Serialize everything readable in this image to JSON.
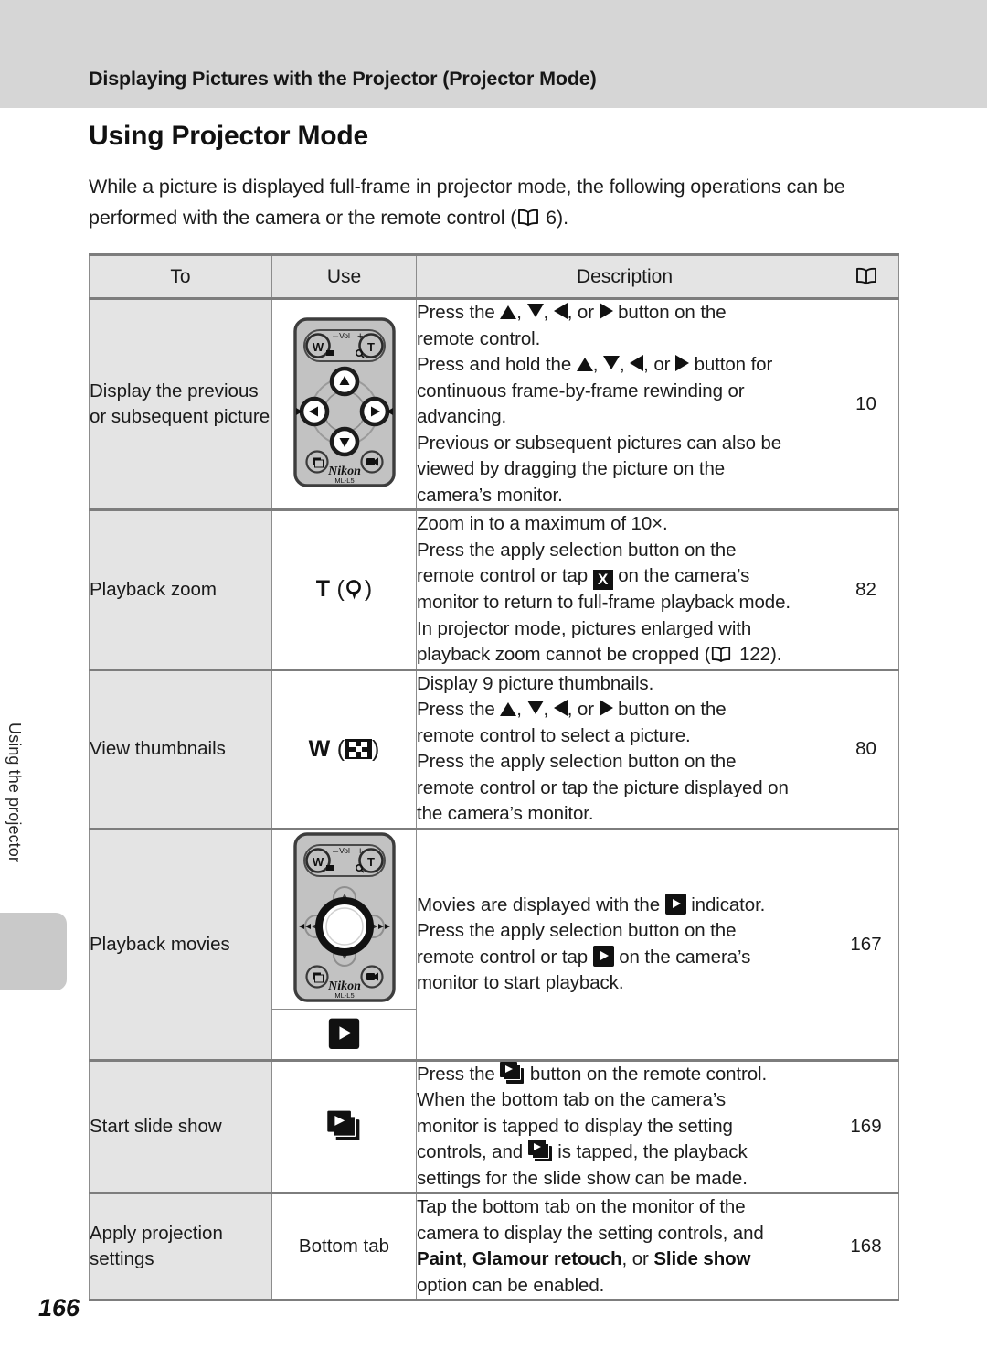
{
  "running_head": "Displaying Pictures with the Projector (Projector Mode)",
  "side_tab": "Using the projector",
  "page_number": "166",
  "section": {
    "title": "Using Projector Mode",
    "intro_line1": "While a picture is displayed full-frame in projector mode, the following operations",
    "intro_line2_before": "can be performed with the camera or the remote control (",
    "intro_line2_after": " 6)."
  },
  "table": {
    "headers": {
      "to": "To",
      "use": "Use",
      "description": "Description",
      "page_ref": "book-icon"
    },
    "rows": [
      {
        "to": "Display the previous or subsequent picture",
        "use_kind": "remote-dpad",
        "desc": [
          "Press the ▲, ▼, ◀, or ▶ button on the",
          "remote control.",
          "Press and hold the ▲, ▼, ◀, or ▶ button for",
          "continuous frame-by-frame rewinding or",
          "advancing.",
          "Previous or subsequent pictures can also be",
          "viewed by dragging the picture on the",
          "camera’s monitor."
        ],
        "page": "10"
      },
      {
        "to": "Playback zoom",
        "use_kind": "T-zoom",
        "use_label": "T",
        "desc": [
          "Zoom in to a maximum of 10×.",
          "Press the apply selection button on the",
          "remote control or tap X on the camera’s",
          "monitor to return to full-frame playback mode.",
          "In projector mode, pictures enlarged with",
          "playback zoom cannot be cropped ( 122)."
        ],
        "page": "82"
      },
      {
        "to": "View thumbnails",
        "use_kind": "W-thumbnails",
        "use_label": "W",
        "desc": [
          "Display 9 picture thumbnails.",
          "Press the ▲, ▼, ◀, or ▶ button on the",
          "remote control to select a picture.",
          "Press the apply selection button on the",
          "remote control or tap the picture displayed on",
          "the camera’s monitor."
        ],
        "page": "80"
      },
      {
        "to": "Playback movies",
        "use_kind": "remote-center",
        "use_kind_sub": "play-badge",
        "desc": [
          "Movies are displayed with the ▶ indicator.",
          "Press the apply selection button on the",
          "remote control or tap ▶ on the camera’s",
          "monitor to start playback."
        ],
        "page": "167"
      },
      {
        "to": "Start slide show",
        "use_kind": "slide-badge",
        "desc": [
          "Press the slideshow button on the remote control.",
          "When the bottom tab on the camera’s",
          "monitor is tapped to display the setting",
          "controls, and slideshow is tapped, the playback",
          "settings for the slide show can be made."
        ],
        "page": "169"
      },
      {
        "to": "Apply projection settings",
        "use_kind": "text",
        "use_label": "Bottom tab",
        "desc": [
          "Tap the bottom tab on the monitor of the",
          "camera to display the setting controls, and",
          "Paint, Glamour retouch, or Slide show",
          "option can be enabled."
        ],
        "desc_bold": [
          "Paint",
          "Glamour retouch",
          "Slide show"
        ],
        "page": "168"
      }
    ]
  },
  "remote": {
    "brand": "Nikon",
    "model": "ML-L5",
    "labels": {
      "w": "W",
      "t": "T",
      "vol": "Vol",
      "minus": "–",
      "plus": "+"
    }
  },
  "colors": {
    "head_band": "#d6d6d6",
    "table_header_bg": "#e4e4e4",
    "col_to_bg": "#e4e4e4",
    "rule": "#7d7d7d",
    "remote_body": "#c2c2c2",
    "text": "#1a1a1a"
  }
}
